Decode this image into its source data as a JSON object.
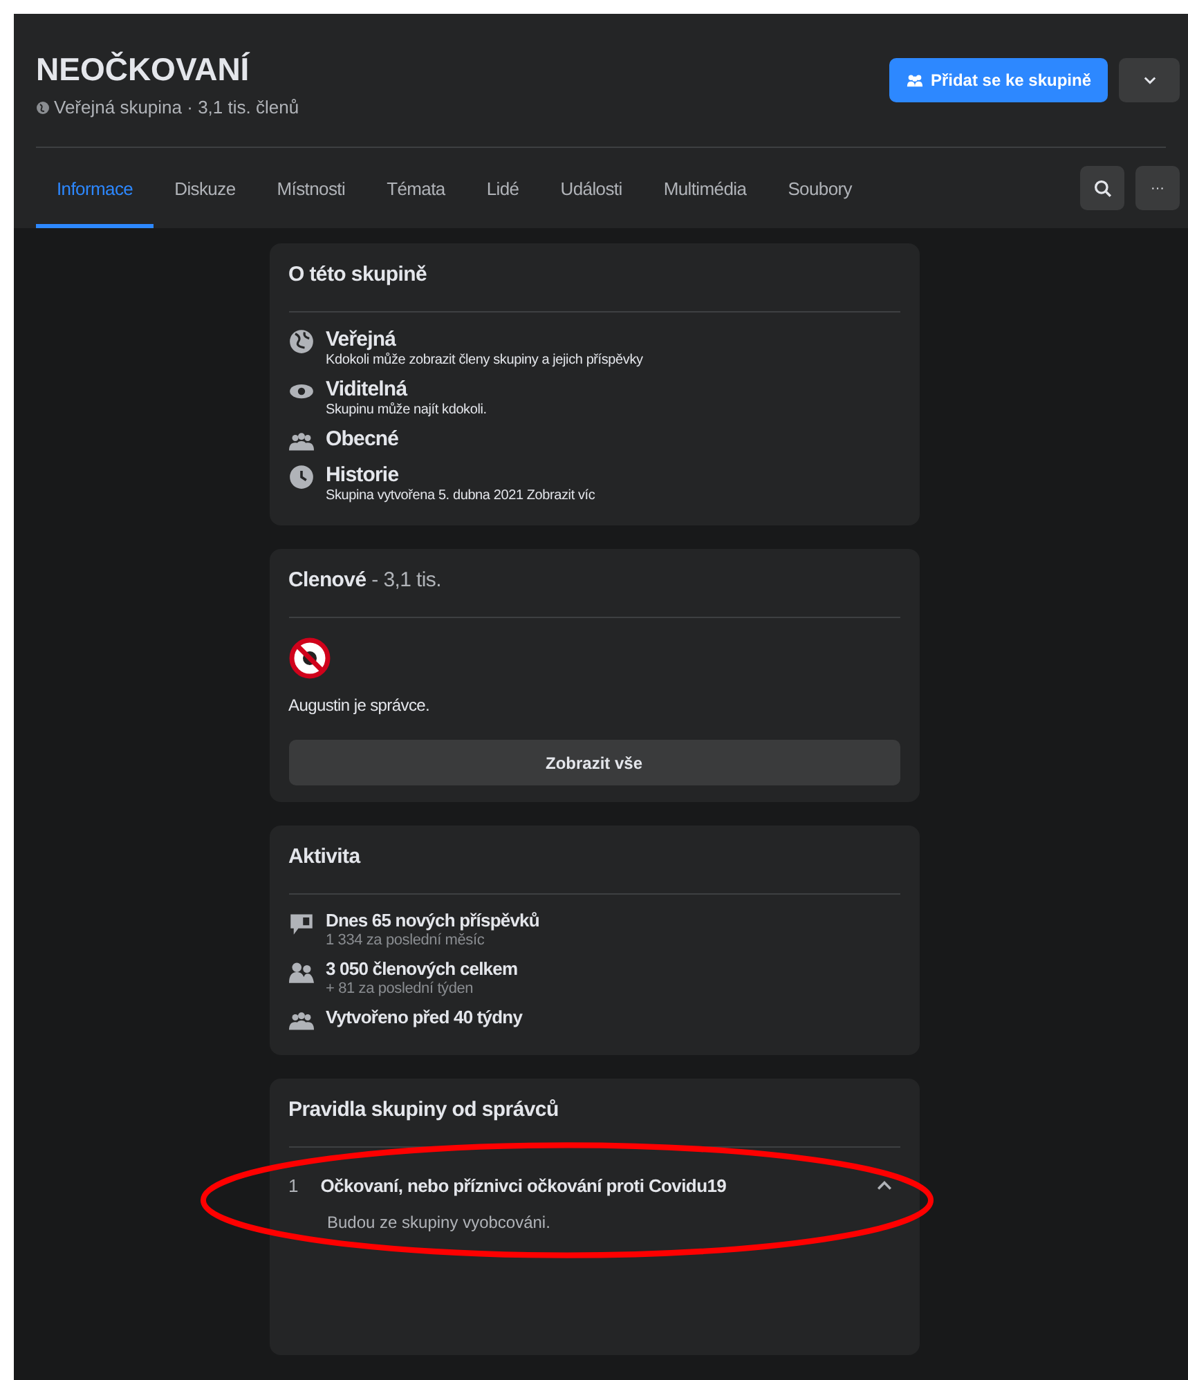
{
  "group": {
    "name": "NEOČKOVANÍ",
    "subtitle": "Veřejná skupina · 3,1 tis. členů",
    "join_button": "Přidat se ke skupině"
  },
  "tabs": [
    {
      "label": "Informace",
      "selected": true
    },
    {
      "label": "Diskuze",
      "selected": false
    },
    {
      "label": "Místnosti",
      "selected": false
    },
    {
      "label": "Témata",
      "selected": false
    },
    {
      "label": "Lidé",
      "selected": false
    },
    {
      "label": "Události",
      "selected": false
    },
    {
      "label": "Multimédia",
      "selected": false
    },
    {
      "label": "Soubory",
      "selected": false
    }
  ],
  "more_button": "···",
  "about": {
    "title": "O této skupině",
    "items": [
      {
        "kind": "globe",
        "title": "Veřejná",
        "text": "Kdokoli může zobrazit členy skupiny a jejich příspěvky"
      },
      {
        "kind": "eye",
        "title": "Viditelná",
        "text": "Skupinu může najít kdokoli."
      },
      {
        "kind": "people",
        "title": "Obecné"
      },
      {
        "kind": "clock",
        "title": "Historie",
        "text": "Skupina vytvořena 5. dubna 2021 Zobrazit víc"
      }
    ]
  },
  "members": {
    "title": "**Clenové** - 3,1 tis.",
    "admin_text": "Augustin je správce.",
    "show_all": "Zobrazit vše"
  },
  "activity": {
    "title": "Aktivita",
    "items": [
      {
        "kind": "chat",
        "title": "Dnes 65 nových příspěvků",
        "text": "1 334 za poslední měsíc"
      },
      {
        "kind": "members",
        "title": "3 050 členových celkem",
        "text": "+ 81 za poslední týden"
      },
      {
        "kind": "people",
        "title": "Vytvořeno před 40 týdny"
      }
    ]
  },
  "rules": {
    "title": "Pravidla skupiny od správců",
    "items": [
      {
        "number": "1",
        "title": "Očkovaní, nebo příznivci očkování proti Covidu19",
        "text": "Budou ze skupiny vyobcováni.",
        "expanded": true
      }
    ]
  }
}
